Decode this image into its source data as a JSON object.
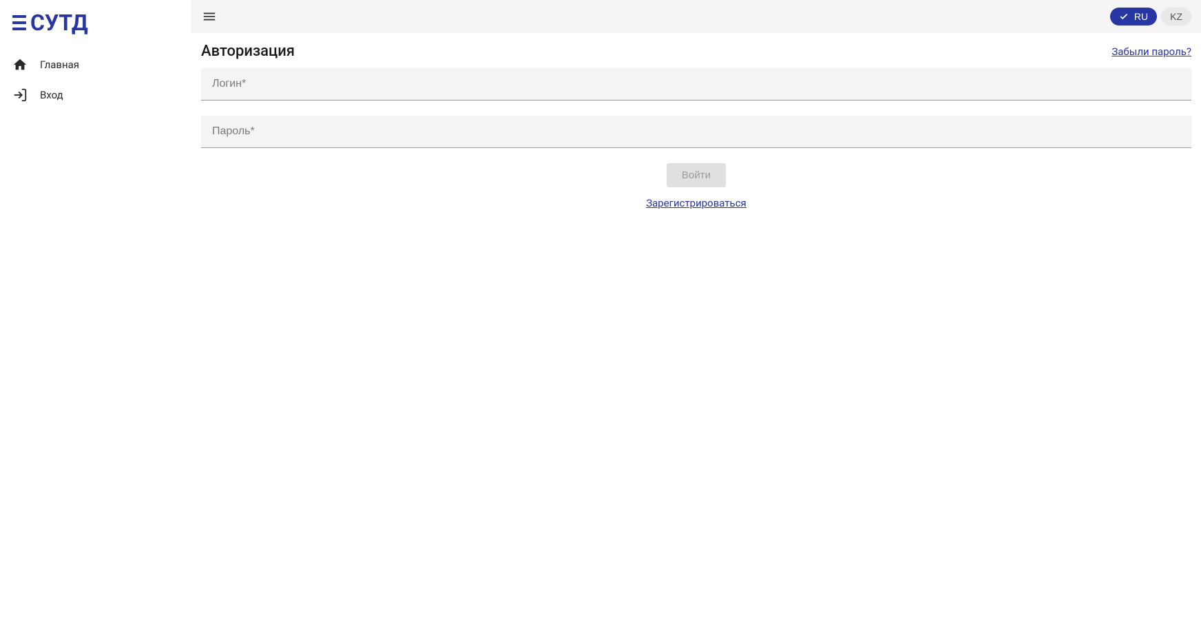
{
  "logo": {
    "text": "СУТД"
  },
  "sidebar": {
    "items": [
      {
        "label": "Главная",
        "icon": "home"
      },
      {
        "label": "Вход",
        "icon": "login"
      }
    ]
  },
  "topbar": {
    "languages": [
      {
        "code": "RU",
        "active": true
      },
      {
        "code": "KZ",
        "active": false
      }
    ]
  },
  "auth": {
    "title": "Авторизация",
    "forgot_password": "Забыли пароль?",
    "login_placeholder": "Логин*",
    "password_placeholder": "Пароль*",
    "submit_label": "Войти",
    "register_label": "Зарегистрироваться"
  }
}
